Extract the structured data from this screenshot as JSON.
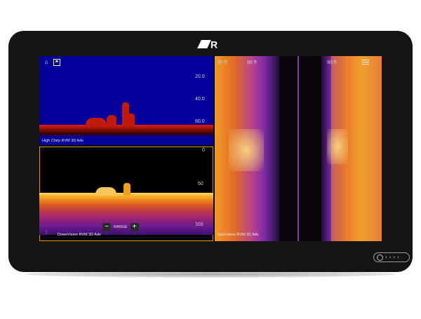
{
  "device": {
    "logo": "R",
    "side_buttons_chevrons": [
      "›",
      "›",
      "›",
      "›"
    ]
  },
  "high_chirp": {
    "label": "High Chirp RVM 3D Adv",
    "scale": [
      "20.0",
      "40.0",
      "60.0"
    ],
    "home_icon": "home-icon",
    "waypoint_icon": "flag-icon"
  },
  "downvision": {
    "label": "DownVision RVM 3D Adv",
    "scale": [
      "0",
      "50",
      "100"
    ],
    "range_label": "RANGE",
    "minus": "−",
    "plus": "+",
    "settings_icon": "sliders-icon"
  },
  "sidevision": {
    "label": "SideVision RVM 3D Adv",
    "range_left": "90 ft",
    "range_right": "90 ft",
    "menu_icon": "hamburger-menu-icon"
  },
  "colors": {
    "chirp_background": "#06009a",
    "active_border": "#f08e00"
  }
}
